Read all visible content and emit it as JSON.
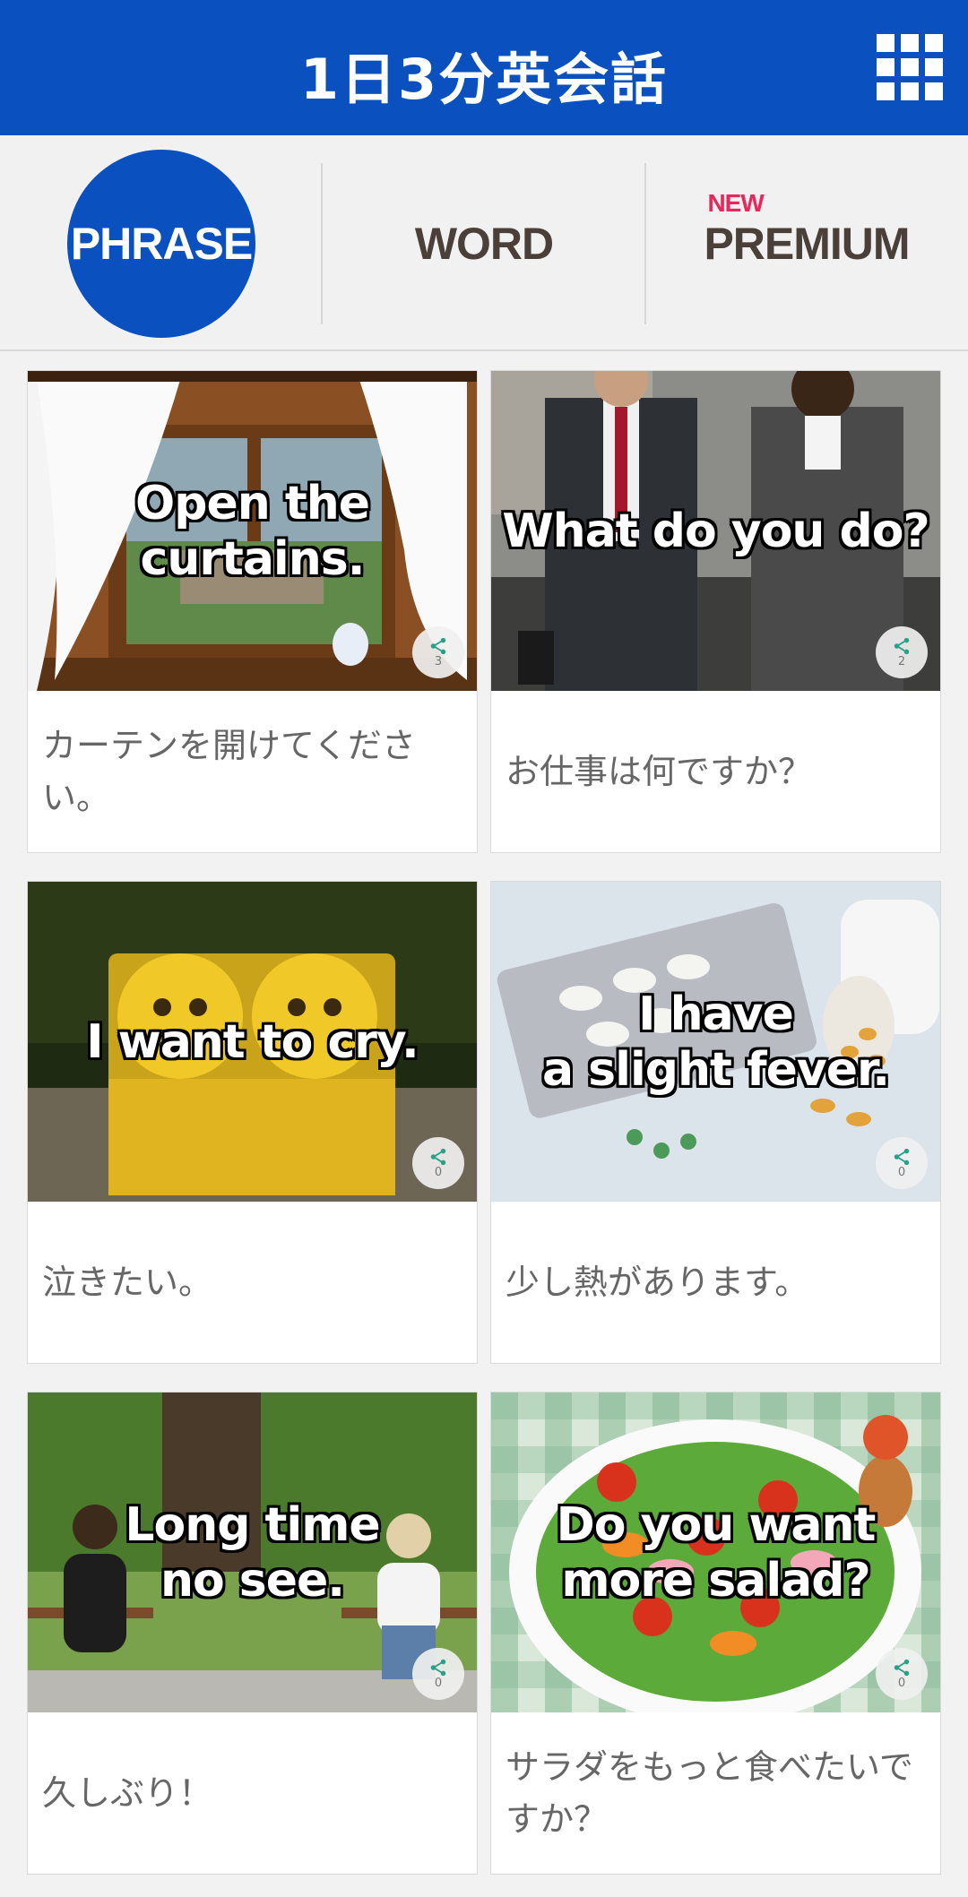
{
  "header": {
    "title": "1日3分英会話",
    "menu_icon": "grid-menu-icon"
  },
  "tabs": {
    "phrase": "PHRASE",
    "word": "WORD",
    "premium_new": "NEW",
    "premium": "PREMIUM"
  },
  "colors": {
    "brand_blue": "#0a50be",
    "new_badge": "#e8275a"
  },
  "cards": [
    {
      "overlay": "Open the\ncurtains.",
      "caption": "カーテンを開けてください。",
      "shares": "3"
    },
    {
      "overlay": "What do you do?",
      "caption": "お仕事は何ですか？",
      "shares": "2"
    },
    {
      "overlay": "I want to cry.",
      "caption": "泣きたい。",
      "shares": "0"
    },
    {
      "overlay": "I have\na slight fever.",
      "caption": "少し熱があります。",
      "shares": "0"
    },
    {
      "overlay": "Long time\nno see.",
      "caption": "久しぶり！",
      "shares": "0"
    },
    {
      "overlay": "Do you want\nmore salad?",
      "caption": "サラダをもっと食べたいですか？",
      "shares": "0"
    }
  ]
}
